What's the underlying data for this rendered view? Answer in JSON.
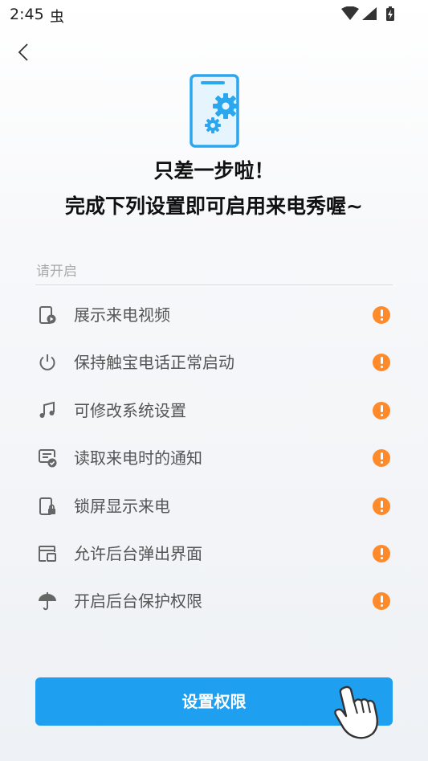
{
  "status_bar": {
    "time": "2:45",
    "app_icon_glyph": "虫",
    "icons": [
      "wifi-icon",
      "cellular-signal-icon",
      "battery-charging-icon"
    ]
  },
  "nav": {
    "back_icon": "chevron-left-icon"
  },
  "hero": {
    "icon": "phone-settings-gears-icon",
    "line1": "只差一步啦！",
    "line2": "完成下列设置即可启用来电秀喔~"
  },
  "section": {
    "label": "请开启"
  },
  "permissions": [
    {
      "icon": "phone-video-icon",
      "label": "展示来电视频",
      "status": "warning-icon"
    },
    {
      "icon": "power-icon",
      "label": "保持触宝电话正常启动",
      "status": "warning-icon"
    },
    {
      "icon": "music-note-icon",
      "label": "可修改系统设置",
      "status": "warning-icon"
    },
    {
      "icon": "notification-check-icon",
      "label": "读取来电时的通知",
      "status": "warning-icon"
    },
    {
      "icon": "phone-lock-icon",
      "label": "锁屏显示来电",
      "status": "warning-icon"
    },
    {
      "icon": "popup-window-icon",
      "label": "允许后台弹出界面",
      "status": "warning-icon"
    },
    {
      "icon": "umbrella-icon",
      "label": "开启后台保护权限",
      "status": "warning-icon"
    }
  ],
  "action": {
    "label": "设置权限",
    "hint_icon": "tap-hand-icon"
  },
  "colors": {
    "accent": "#1f9ff0",
    "warning": "#ff8a2a",
    "icon_gray": "#666666"
  }
}
